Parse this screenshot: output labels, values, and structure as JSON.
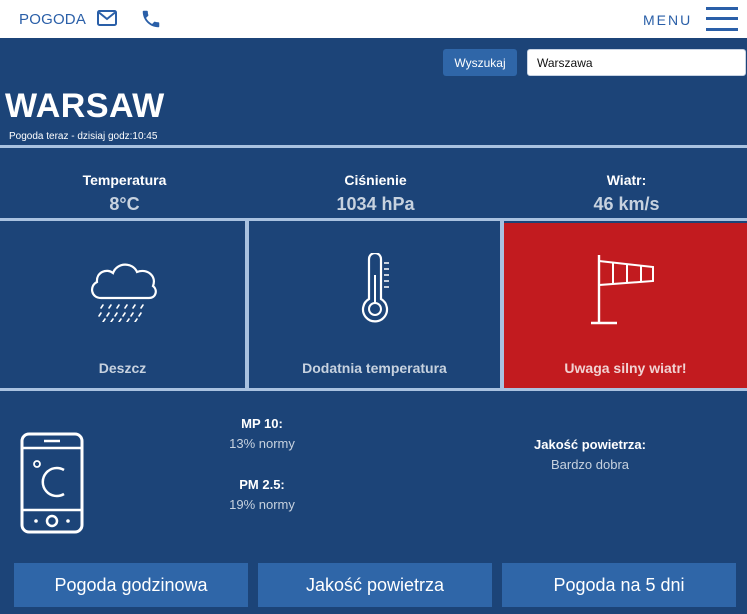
{
  "header": {
    "brand": "POGODA",
    "menu_label": "MENU",
    "mail_icon": "mail-icon",
    "phone_icon": "phone-icon",
    "hamburger_icon": "hamburger-icon"
  },
  "search": {
    "button_label": "Wyszukaj",
    "value": "Warszawa"
  },
  "location": {
    "city": "WARSAW",
    "subtitle": "Pogoda teraz - dzisiaj godz:10:45"
  },
  "stats": [
    {
      "label": "Temperatura",
      "value": "8°C"
    },
    {
      "label": "Ciśnienie",
      "value": "1034 hPa"
    },
    {
      "label": "Wiatr:",
      "value": "46 km/s"
    }
  ],
  "tiles": [
    {
      "icon": "rain-cloud-icon",
      "caption": "Deszcz"
    },
    {
      "icon": "thermometer-icon",
      "caption": "Dodatnia temperatura"
    },
    {
      "icon": "windsock-icon",
      "caption": "Uwaga silny wiatr!"
    }
  ],
  "air": {
    "device_icon": "phone-celsius-icon",
    "pm10": {
      "label": "MP 10:",
      "value": "13% normy"
    },
    "pm25": {
      "label": "PM 2.5:",
      "value": "19% normy"
    },
    "quality": {
      "label": "Jakość powietrza:",
      "value": "Bardzo dobra"
    }
  },
  "nav": [
    {
      "label": "Pogoda godzinowa"
    },
    {
      "label": "Jakość powietrza"
    },
    {
      "label": "Pogoda na 5 dni"
    }
  ],
  "colors": {
    "background": "#1c4478",
    "button": "#2f66a8",
    "divider": "#a9c2e0",
    "alert": "#c21b1f",
    "header_text": "#2a5fa8"
  }
}
